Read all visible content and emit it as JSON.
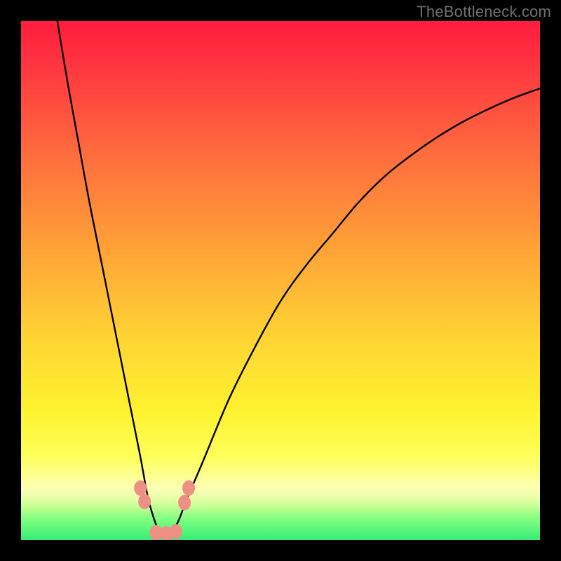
{
  "watermark": "TheBottleneck.com",
  "chart_data": {
    "type": "line",
    "title": "",
    "xlabel": "",
    "ylabel": "",
    "xlim": [
      0,
      100
    ],
    "ylim": [
      0,
      100
    ],
    "series": [
      {
        "name": "bottleneck-curve",
        "x": [
          7,
          9,
          11,
          13,
          15,
          17,
          19,
          21,
          23,
          24.5,
          26,
          27,
          28,
          30,
          32,
          35,
          40,
          45,
          50,
          55,
          60,
          65,
          70,
          75,
          80,
          85,
          90,
          95,
          100
        ],
        "values": [
          100,
          88,
          77,
          66,
          56,
          46,
          36,
          26,
          16,
          8,
          3,
          1,
          1,
          3,
          8,
          15,
          27,
          37,
          46,
          53,
          59,
          65,
          70,
          74,
          77.5,
          80.5,
          83,
          85.2,
          87
        ]
      }
    ],
    "markers": [
      {
        "name": "marker-left-upper",
        "x": 23.0,
        "y": 10.0
      },
      {
        "name": "marker-left-lower",
        "x": 23.8,
        "y": 7.4
      },
      {
        "name": "marker-bottom-left",
        "x": 26.0,
        "y": 1.4
      },
      {
        "name": "marker-bottom-mid",
        "x": 28.0,
        "y": 1.2
      },
      {
        "name": "marker-bottom-right",
        "x": 29.8,
        "y": 1.6
      },
      {
        "name": "marker-right-lower",
        "x": 31.5,
        "y": 7.2
      },
      {
        "name": "marker-right-upper",
        "x": 32.3,
        "y": 10.0
      }
    ],
    "gradient_stops": [
      {
        "pos": 0.0,
        "color": "#ff1d3e"
      },
      {
        "pos": 0.45,
        "color": "#ffa636"
      },
      {
        "pos": 0.75,
        "color": "#fff22f"
      },
      {
        "pos": 1.0,
        "color": "#35ec76"
      }
    ]
  }
}
